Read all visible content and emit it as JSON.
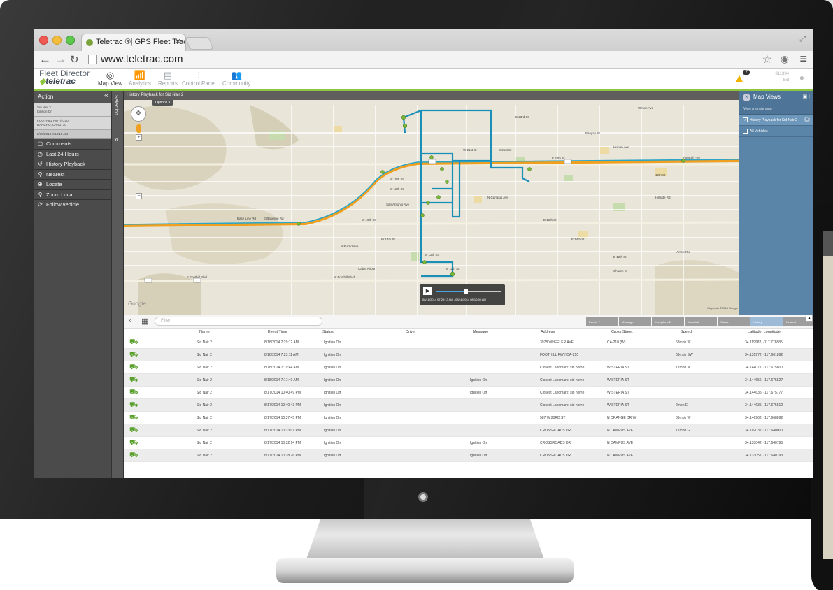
{
  "browser": {
    "tab_title": "Teletrac ®| GPS Fleet Track",
    "url": "www.teletrac.com"
  },
  "app": {
    "logo_top": "Fleet Director",
    "logo_bottom": "teletrac",
    "nav": [
      {
        "label": "Map View",
        "icon": "globe-icon"
      },
      {
        "label": "Analytics",
        "icon": "chart-icon"
      },
      {
        "label": "Reports",
        "icon": "document-icon"
      },
      {
        "label": "Control Panel",
        "icon": "sliders-icon"
      },
      {
        "label": "Community",
        "icon": "people-icon"
      }
    ],
    "alert_count": "7",
    "user_id": "311394",
    "user_name": "Sid"
  },
  "sidebar": {
    "title": "Action",
    "info_line1": "Sid Nair 2",
    "info_line2": "Ignition On",
    "address_line1": "FOOTHILL FWY/I-210",
    "address_line2": "RANCHO, CA 91730",
    "timestamp": "8/18/2014 8:14:10 AM",
    "items": [
      {
        "label": "Comments",
        "icon": "comment-icon"
      },
      {
        "label": "Last 24 Hours",
        "icon": "clock-icon"
      },
      {
        "label": "History Playback",
        "icon": "history-icon"
      },
      {
        "label": "Nearest",
        "icon": "pin-icon"
      },
      {
        "label": "Locate",
        "icon": "target-icon"
      },
      {
        "label": "Zoom Local",
        "icon": "zoom-icon"
      },
      {
        "label": "Follow vehicle",
        "icon": "refresh-icon"
      }
    ]
  },
  "selection": {
    "label": "Selection"
  },
  "map": {
    "title": "History Playback for Sid Nair 2",
    "options_label": "Options",
    "google": "Google",
    "credit": "Map data ©2014 Google",
    "player_time": "08/18/2014 07:29:13 AM - 08/18/2014 08:10:50 AM",
    "street_labels": [
      "Wilson Ave",
      "E 23rd St",
      "Banyan St",
      "Lemon Ave",
      "W 21st St",
      "E 21st St",
      "E 20th St",
      "19th St",
      "W 19th St",
      "W 18th St",
      "W 16th St",
      "E 16th St",
      "Base Line Rd",
      "E Baseline Rd",
      "W 14th St",
      "E 14th St",
      "W 12th St",
      "E 12th St",
      "W 11th St",
      "Foothill Fwy",
      "E Foothill Blvd",
      "W Foothill Blvd",
      "Cable Airport",
      "Church St",
      "Arrow Rte",
      "Hillside Rd",
      "N Euclid Ave",
      "San Antonio Ave",
      "N Campus Ave"
    ]
  },
  "map_views": {
    "title": "Map Views",
    "subtitle": "View a single map",
    "items": [
      {
        "label": "History Playback for Sid Nair 2",
        "checked": true
      },
      {
        "label": "All Vehicles",
        "checked": false
      }
    ]
  },
  "grid": {
    "filter_placeholder": "Filter",
    "tabs": [
      {
        "label": "Events",
        "count": "7"
      },
      {
        "label": "Messages",
        "count": ""
      },
      {
        "label": "Exceptions",
        "count": "2"
      },
      {
        "label": "Watchlist",
        "count": ""
      },
      {
        "label": "Status",
        "count": ""
      },
      {
        "label": "History",
        "count": ""
      },
      {
        "label": "Nearest",
        "count": ""
      }
    ],
    "columns": [
      "Name",
      "Event Time",
      "Status",
      "Driver",
      "Message",
      "Address",
      "Cross Street",
      "Speed",
      "Latitude, Longitude"
    ],
    "rows": [
      [
        "Sid Nair 2",
        "8/18/2014 7:29:12 AM",
        "Ignition On",
        "",
        "",
        "3978 WHEELER AVE",
        "CA-210 (W)",
        "68mph W",
        "34.119982, -117.776885"
      ],
      [
        "Sid Nair 2",
        "8/18/2014 7:23:11 AM",
        "Ignition On",
        "",
        "",
        "FOOTHILL FWY/CA-210",
        "",
        "69mph SW",
        "34.131972, -117.661892"
      ],
      [
        "Sid Nair 2",
        "8/18/2014 7:19:44 AM",
        "Ignition On",
        "",
        "",
        "Closest Landmark: sid home",
        "WISTERIA ST",
        "17mph N",
        "34.144077, -117.675800"
      ],
      [
        "Sid Nair 2",
        "8/18/2014 7:17:40 AM",
        "Ignition On",
        "",
        "Ignition On",
        "Closest Landmark: sid home",
        "WISTERIA ST",
        "",
        "34.144656, -117.675827"
      ],
      [
        "Sid Nair 2",
        "8/17/2014 10:40:49 PM",
        "Ignition Off",
        "",
        "Ignition Off",
        "Closest Landmark: sid home",
        "WISTERIA ST",
        "",
        "34.144635, -117.675777"
      ],
      [
        "Sid Nair 2",
        "8/17/2014 10:40:43 PM",
        "Ignition On",
        "",
        "",
        "Closest Landmark: sid home",
        "WISTERIA ST",
        "2mph E",
        "34.144635, -117.675812"
      ],
      [
        "Sid Nair 2",
        "8/17/2014 10:37:45 PM",
        "Ignition On",
        "",
        "",
        "587 W 23RD ST",
        "N ORANGE DR W",
        "39mph W",
        "34.146962, -117.668892"
      ],
      [
        "Sid Nair 2",
        "8/17/2014 10:33:01 PM",
        "Ignition On",
        "",
        "",
        "CROSSROADS DR",
        "N CAMPUS AVE",
        "17mph G",
        "34.102032, -117.640000"
      ],
      [
        "Sid Nair 2",
        "8/17/2014 10:32:14 PM",
        "Ignition On",
        "",
        "Ignition On",
        "CROSSROADS DR",
        "N CAMPUS AVE",
        "",
        "34.133042, -117.640795"
      ],
      [
        "Sid Nair 2",
        "8/17/2014 10:18:26 PM",
        "Ignition Off",
        "",
        "Ignition Off",
        "CROSSROADS DR",
        "N CAMPUS AVE",
        "",
        "34.133057, -117.640793"
      ]
    ]
  },
  "colors": {
    "accent_green": "#8ec63f",
    "route_blue": "#1a8fb8",
    "freeway_orange": "#f0a020",
    "sidebar_gray": "#4b4b4b",
    "panel_blue": "#5a84a8"
  }
}
